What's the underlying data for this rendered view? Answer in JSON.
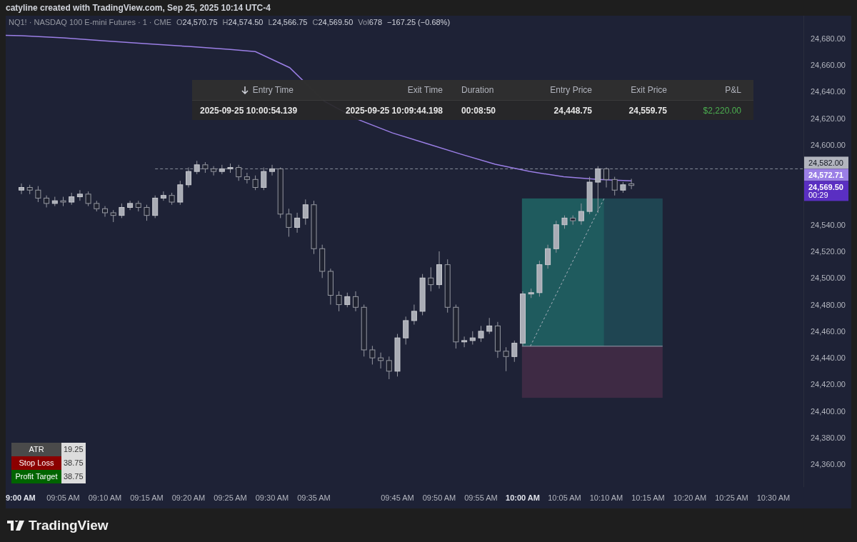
{
  "header": {
    "caption": "catyline created with TradingView.com, Sep 25, 2025 10:14 UTC-4"
  },
  "chart": {
    "legend": {
      "symbol": "NQ1! · NASDAQ 100 E-mini Futures · 1 · CME",
      "fields": [
        {
          "label": "O",
          "value": "24,570.75"
        },
        {
          "label": "H",
          "value": "24,574.50"
        },
        {
          "label": "L",
          "value": "24,566.75"
        },
        {
          "label": "C",
          "value": "24,569.50"
        },
        {
          "label": "Vol",
          "value": "678"
        }
      ],
      "change": "−167.25 (−0.68%)"
    },
    "chart_data": {
      "type": "candlestick",
      "categories": [
        "9:00 AM",
        null,
        null,
        null,
        null,
        "09:05 AM",
        null,
        null,
        null,
        null,
        "09:10 AM",
        null,
        null,
        null,
        null,
        "09:15 AM",
        null,
        null,
        null,
        null,
        "09:20 AM",
        null,
        null,
        null,
        null,
        "09:25 AM",
        null,
        null,
        null,
        null,
        "09:30 AM",
        null,
        null,
        null,
        null,
        "09:35 AM",
        null,
        null,
        null,
        null,
        null,
        null,
        null,
        null,
        null,
        "09:45 AM",
        null,
        null,
        null,
        null,
        "09:50 AM",
        null,
        null,
        null,
        null,
        "09:55 AM",
        null,
        null,
        null,
        null,
        "10:00 AM",
        null,
        null,
        null,
        null,
        "10:05 AM",
        null,
        null,
        null,
        null,
        "10:10 AM",
        null,
        null,
        null,
        null,
        "10:15 AM",
        null,
        null,
        null,
        null,
        "10:20 AM",
        null,
        null,
        null,
        null,
        "10:25 AM",
        null,
        null,
        null,
        null,
        "10:30 AM"
      ],
      "ohlc": [
        [
          24566,
          24571,
          24563,
          24568
        ],
        [
          24568,
          24570,
          24563,
          24566
        ],
        [
          24566,
          24569,
          24557,
          24560
        ],
        [
          24560,
          24562,
          24553,
          24556
        ],
        [
          24556,
          24561,
          24554,
          24558
        ],
        [
          24558,
          24561,
          24554,
          24557
        ],
        [
          24557,
          24564,
          24555,
          24561
        ],
        [
          24561,
          24566,
          24558,
          24563
        ],
        [
          24563,
          24565,
          24554,
          24556
        ],
        [
          24556,
          24558,
          24550,
          24552
        ],
        [
          24552,
          24554,
          24546,
          24549
        ],
        [
          24549,
          24551,
          24542,
          24547
        ],
        [
          24547,
          24556,
          24545,
          24553
        ],
        [
          24553,
          24558,
          24551,
          24556
        ],
        [
          24556,
          24558,
          24550,
          24553
        ],
        [
          24553,
          24555,
          24543,
          24547
        ],
        [
          24547,
          24562,
          24545,
          24560
        ],
        [
          24560,
          24565,
          24558,
          24562
        ],
        [
          24562,
          24564,
          24555,
          24557
        ],
        [
          24557,
          24573,
          24555,
          24570
        ],
        [
          24570,
          24583,
          24568,
          24580
        ],
        [
          24580,
          24588,
          24578,
          24585
        ],
        [
          24585,
          24587,
          24579,
          24582
        ],
        [
          24582,
          24584,
          24577,
          24580
        ],
        [
          24580,
          24585,
          24578,
          24582
        ],
        [
          24582,
          24586,
          24579,
          24583
        ],
        [
          24583,
          24585,
          24573,
          24576
        ],
        [
          24576,
          24579,
          24571,
          24574
        ],
        [
          24574,
          24577,
          24566,
          24568
        ],
        [
          24568,
          24583,
          24566,
          24580
        ],
        [
          24580,
          24585,
          24577,
          24582
        ],
        [
          24582,
          24583,
          24545,
          24548
        ],
        [
          24548,
          24552,
          24531,
          24538
        ],
        [
          24538,
          24549,
          24534,
          24545
        ],
        [
          24545,
          24559,
          24540,
          24555
        ],
        [
          24555,
          24558,
          24518,
          24522
        ],
        [
          24522,
          24525,
          24500,
          24505
        ],
        [
          24505,
          24507,
          24480,
          24487
        ],
        [
          24487,
          24490,
          24475,
          24480
        ],
        [
          24480,
          24489,
          24478,
          24486
        ],
        [
          24486,
          24490,
          24475,
          24478
        ],
        [
          24478,
          24480,
          24441,
          24446
        ],
        [
          24446,
          24449,
          24435,
          24440
        ],
        [
          24440,
          24444,
          24432,
          24438
        ],
        [
          24438,
          24441,
          24424,
          24430
        ],
        [
          24430,
          24458,
          24426,
          24455
        ],
        [
          24455,
          24471,
          24450,
          24468
        ],
        [
          24468,
          24480,
          24465,
          24475
        ],
        [
          24475,
          24503,
          24472,
          24500
        ],
        [
          24500,
          24508,
          24490,
          24495
        ],
        [
          24495,
          24520,
          24492,
          24510
        ],
        [
          24510,
          24514,
          24474,
          24478
        ],
        [
          24478,
          24480,
          24447,
          24452
        ],
        [
          24452,
          24456,
          24448,
          24453
        ],
        [
          24453,
          24460,
          24450,
          24455
        ],
        [
          24455,
          24464,
          24452,
          24460
        ],
        [
          24460,
          24470,
          24458,
          24464
        ],
        [
          24464,
          24467,
          24440,
          24445
        ],
        [
          24445,
          24448,
          24430,
          24441
        ],
        [
          24441,
          24453,
          24437,
          24451
        ],
        [
          24451,
          24490,
          24449,
          24488
        ],
        [
          24488,
          24492,
          24485,
          24489
        ],
        [
          24489,
          24513,
          24486,
          24510
        ],
        [
          24510,
          24525,
          24507,
          24522
        ],
        [
          24522,
          24543,
          24519,
          24540
        ],
        [
          24540,
          24547,
          24537,
          24545
        ],
        [
          24545,
          24547,
          24540,
          24543
        ],
        [
          24543,
          24556,
          24540,
          24550
        ],
        [
          24550,
          24576,
          24548,
          24572
        ],
        [
          24572,
          24584,
          24549,
          24582
        ],
        [
          24582,
          24583,
          24568,
          24574
        ],
        [
          24574,
          24576,
          24562,
          24566
        ],
        [
          24566,
          24572,
          24564,
          24570
        ],
        [
          24570.75,
          24574.5,
          24566.75,
          24569.5
        ],
        null,
        null,
        null,
        null,
        null,
        null,
        null,
        null,
        null,
        null,
        null,
        null,
        null,
        null,
        null,
        null,
        null
      ],
      "ylim": [
        24343,
        24697
      ],
      "yticks": [
        {
          "value": 24680,
          "label": "24,680.00"
        },
        {
          "value": 24660,
          "label": "24,660.00"
        },
        {
          "value": 24640,
          "label": "24,640.00"
        },
        {
          "value": 24620,
          "label": "24,620.00"
        },
        {
          "value": 24600,
          "label": "24,600.00"
        },
        {
          "value": 24540,
          "label": "24,540.00"
        },
        {
          "value": 24520,
          "label": "24,520.00"
        },
        {
          "value": 24500,
          "label": "24,500.00"
        },
        {
          "value": 24480,
          "label": "24,480.00"
        },
        {
          "value": 24460,
          "label": "24,460.00"
        },
        {
          "value": 24440,
          "label": "24,440.00"
        },
        {
          "value": 24420,
          "label": "24,420.00"
        },
        {
          "value": 24400,
          "label": "24,400.00"
        },
        {
          "value": 24380,
          "label": "24,380.00"
        },
        {
          "value": 24360,
          "label": "24,360.00"
        }
      ]
    },
    "price_labels": [
      {
        "kind": "level",
        "text": "24,582.00"
      },
      {
        "kind": "average",
        "text": "24,572.71"
      },
      {
        "kind": "last",
        "text": "24,569.50",
        "countdown": "00:29"
      }
    ],
    "trades": {
      "columns": [
        {
          "label": "Entry Time",
          "sorted": true
        },
        {
          "label": "Exit Time",
          "sorted": false
        },
        {
          "label": "Duration",
          "sorted": false
        },
        {
          "label": "Entry Price",
          "sorted": false
        },
        {
          "label": "Exit Price",
          "sorted": false
        },
        {
          "label": "P&L",
          "sorted": false
        }
      ],
      "rows": [
        {
          "cells": [
            "2025-09-25 10:00:54.139",
            "2025-09-25 10:09:44.198",
            "00:08:50",
            "24,448.75",
            "24,559.75",
            "$2,220.00"
          ],
          "profitable": true
        }
      ]
    },
    "atr_panel": {
      "rows": [
        {
          "label": "ATR",
          "value": "19.25",
          "color": "#4a4a4a"
        },
        {
          "label": "Stop Loss",
          "value": "38.75",
          "color": "#8b0000"
        },
        {
          "label": "Profit Target",
          "value": "38.75",
          "color": "#006400"
        }
      ]
    }
  },
  "footer": {
    "brand": "TradingView"
  }
}
